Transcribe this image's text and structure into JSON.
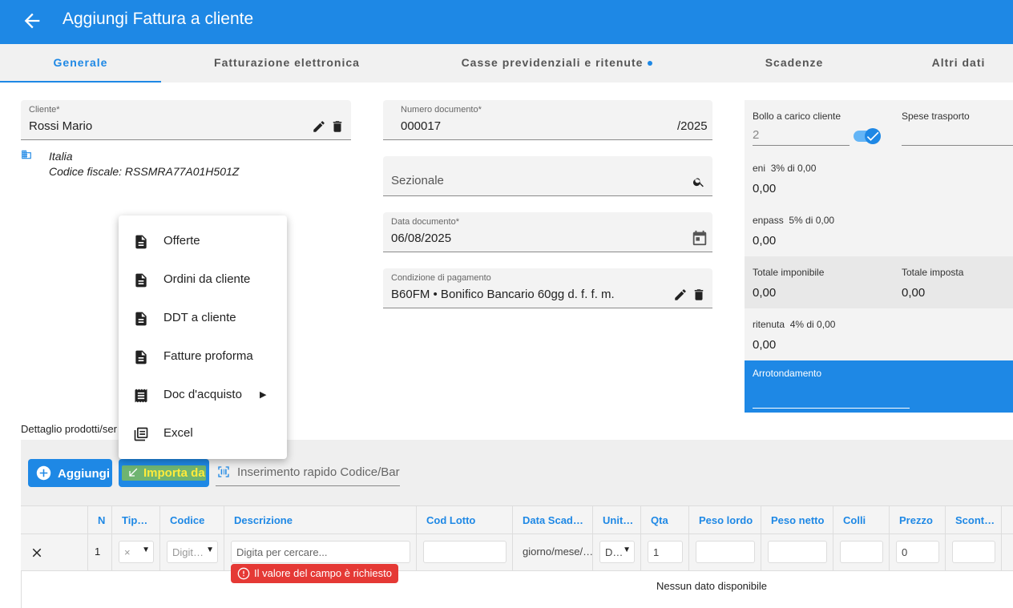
{
  "header": {
    "title": "Aggiungi Fattura a cliente"
  },
  "tabs": [
    {
      "label": "Generale"
    },
    {
      "label": "Fatturazione elettronica"
    },
    {
      "label": "Casse previdenziali e ritenute"
    },
    {
      "label": "Scadenze"
    },
    {
      "label": "Altri dati"
    }
  ],
  "cliente": {
    "label": "Cliente*",
    "value": "Rossi Mario",
    "country": "Italia",
    "tax_code": "Codice fiscale: RSSMRA77A01H501Z"
  },
  "numero": {
    "label": "Numero documento*",
    "value": "000017",
    "suffix": "/2025"
  },
  "sezionale": {
    "placeholder": "Sezionale"
  },
  "data": {
    "label": "Data documento*",
    "value": "06/08/2025"
  },
  "condizione": {
    "label": "Condizione di pagamento",
    "value": "B60FM • Bonifico Bancario 60gg d. f. f. m."
  },
  "panel": {
    "bollo_label": "Bollo a carico cliente",
    "bollo_value": "2",
    "spese_label": "Spese trasporto",
    "eni_label": "eni",
    "eni_sub": "3% di 0,00",
    "eni_value": "0,00",
    "enpass_label": "enpass",
    "enpass_sub": "5% di 0,00",
    "enpass_value": "0,00",
    "imponibile_label": "Totale imponibile",
    "imponibile_value": "0,00",
    "imposta_label": "Totale imposta",
    "imposta_value": "0,00",
    "ritenuta_label": "ritenuta",
    "ritenuta_sub": "4% di 0,00",
    "ritenuta_value": "0,00",
    "arrotondamento_label": "Arrotondamento",
    "accent": "#1e88e5"
  },
  "menu": {
    "items": [
      {
        "label": "Offerte",
        "icon": "document-icon"
      },
      {
        "label": "Ordini da cliente",
        "icon": "document-icon"
      },
      {
        "label": "DDT a cliente",
        "icon": "document-icon"
      },
      {
        "label": "Fatture proforma",
        "icon": "document-icon"
      },
      {
        "label": "Doc d'acquisto",
        "icon": "receipt-icon"
      },
      {
        "label": "Excel",
        "icon": "spreadsheet-icon"
      }
    ]
  },
  "dettaglio": {
    "section_label": "Dettaglio prodotti/ser",
    "add_label": "Aggiungi",
    "import_label": "Importa da",
    "quick_placeholder": "Inserimento rapido Codice/Bar"
  },
  "grid": {
    "headers": [
      "N",
      "Tip…",
      "Codice",
      "Descrizione",
      "Cod Lotto",
      "Data Scad…",
      "Unit…",
      "Qta",
      "Peso lordo",
      "Peso netto",
      "Colli",
      "Prezzo",
      "Scont…"
    ],
    "row": {
      "n": "1",
      "tipo": "×",
      "codice": "Digit…",
      "descrizione_placeholder": "Digita per cercare...",
      "data_scad": "giorno/mese/…",
      "unita": "D…",
      "qta": "1",
      "prezzo": "0"
    },
    "error": "Il valore del campo è richiesto",
    "empty": "Nessun dato disponibile"
  }
}
